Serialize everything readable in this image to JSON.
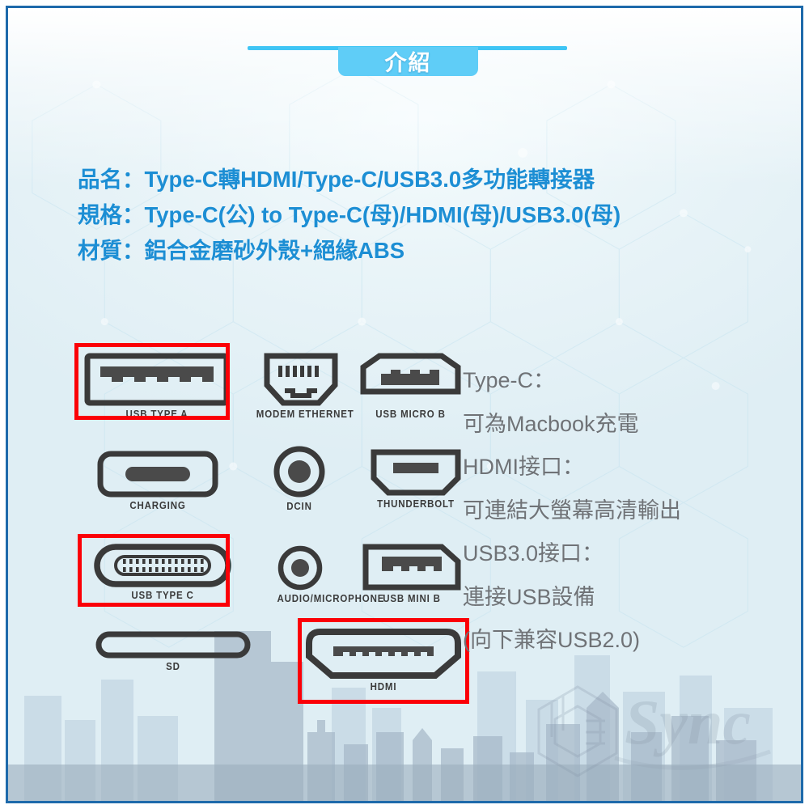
{
  "header": {
    "tab_label": "介紹",
    "accent_color": "#5fcdf7",
    "line_color": "#3fc5f5"
  },
  "frame": {
    "border_color": "#1e6aab",
    "background_color": "#e3eef4"
  },
  "specs": {
    "text_color": "#1c8ed4",
    "lines": [
      "品名：Type-C轉HDMI/Type-C/USB3.0多功能轉接器",
      "規格：Type-C(公) to Type-C(母)/HDMI(母)/USB3.0(母)",
      "材質：鋁合金磨砂外殼+絕緣ABS"
    ]
  },
  "connectors": {
    "highlight_color": "#fb0007",
    "items": [
      {
        "id": "usb-type-a",
        "label": "USB TYPE A",
        "icon": "usb-type-a-icon",
        "highlighted": true
      },
      {
        "id": "modem-ethernet",
        "label": "MODEM ETHERNET",
        "icon": "ethernet-icon",
        "highlighted": false
      },
      {
        "id": "usb-micro-b",
        "label": "USB MICRO B",
        "icon": "usb-micro-b-icon",
        "highlighted": false
      },
      {
        "id": "charging",
        "label": "CHARGING",
        "icon": "charging-icon",
        "highlighted": false
      },
      {
        "id": "dcin",
        "label": "DCIN",
        "icon": "dc-in-icon",
        "highlighted": false
      },
      {
        "id": "thunderbolt",
        "label": "THUNDERBOLT",
        "icon": "thunderbolt-icon",
        "highlighted": false
      },
      {
        "id": "usb-type-c",
        "label": "USB TYPE C",
        "icon": "usb-type-c-icon",
        "highlighted": true
      },
      {
        "id": "audio-microphone",
        "label": "AUDIO/MICROPHONE",
        "icon": "audio-jack-icon",
        "highlighted": false
      },
      {
        "id": "usb-mini-b",
        "label": "USB MINI B",
        "icon": "usb-mini-b-icon",
        "highlighted": false
      },
      {
        "id": "sd",
        "label": "SD",
        "icon": "sd-card-slot-icon",
        "highlighted": false
      },
      {
        "id": "hdmi",
        "label": "HDMI",
        "icon": "hdmi-icon",
        "highlighted": true
      }
    ]
  },
  "descriptions": {
    "text_color": "#6f7276",
    "lines": [
      "Type-C：",
      "可為Macbook充電",
      "HDMI接口：",
      "可連結大螢幕高清輸出",
      "USB3.0接口：",
      "連接USB設備",
      "(向下兼容USB2.0)"
    ]
  },
  "watermark": {
    "text": "Sync",
    "icon": "cube-logo-icon"
  }
}
